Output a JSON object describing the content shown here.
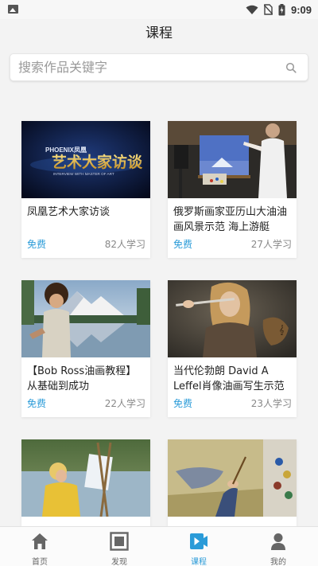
{
  "status_bar": {
    "time": "9:09"
  },
  "header": {
    "title": "课程"
  },
  "search": {
    "placeholder": "搜索作品关键字"
  },
  "courses": [
    {
      "title": "凤凰艺术大家访谈",
      "price": "免费",
      "learners": "82人学习",
      "thumb_text": "艺术大家访谈",
      "thumb_sub": "PHOENIX凤凰",
      "thumb_caption": "INTERVIEW WITH MASTER OF ART"
    },
    {
      "title": "俄罗斯画家亚历山大油油画风景示范 海上游艇",
      "price": "免费",
      "learners": "27人学习"
    },
    {
      "title": "【Bob Ross油画教程】从基础到成功",
      "price": "免费",
      "learners": "22人学习"
    },
    {
      "title": "当代伦勃朗 David A Leffel肖像油画写生示范",
      "price": "免费",
      "learners": "23人学习"
    },
    {
      "title": "",
      "price": "",
      "learners": ""
    },
    {
      "title": "",
      "price": "",
      "learners": ""
    }
  ],
  "tabs": [
    {
      "label": "首页",
      "icon": "home-icon",
      "active": false
    },
    {
      "label": "发现",
      "icon": "discover-icon",
      "active": false
    },
    {
      "label": "课程",
      "icon": "course-icon",
      "active": true
    },
    {
      "label": "我的",
      "icon": "profile-icon",
      "active": false
    }
  ],
  "colors": {
    "accent": "#2a9bd8",
    "background": "#f3f3f3"
  }
}
